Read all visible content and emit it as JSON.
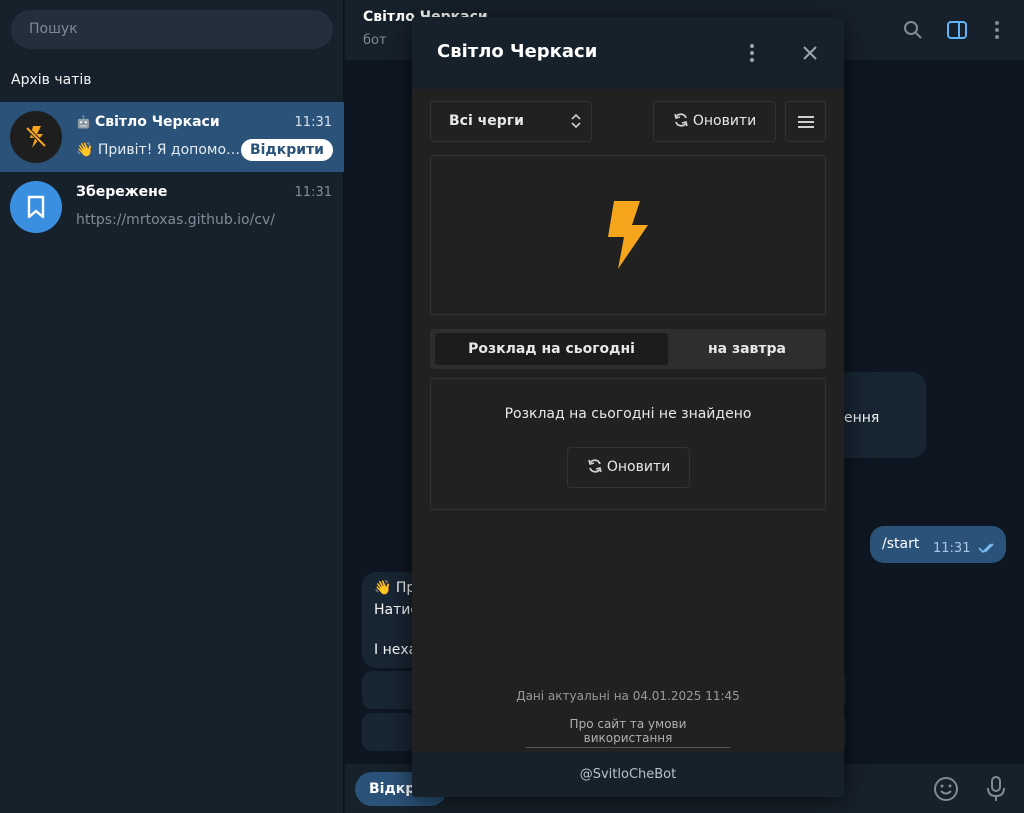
{
  "sidebar": {
    "search_placeholder": "Пошук",
    "archive_title": "Архів чатів",
    "chats": [
      {
        "name": "Світло Черкаси",
        "time": "11:31",
        "preview": "👋 Привіт! Я допомож...",
        "action": "Відкрити",
        "bot_icon": "bot-icon"
      },
      {
        "name": "Збережене",
        "time": "11:31",
        "preview": "https://mrtoxas.github.io/cv/"
      }
    ]
  },
  "chat": {
    "title": "Світло Черкаси",
    "subtitle": "бот",
    "messages": {
      "incoming_partial_1": "ення",
      "outgoing_text": "/start",
      "outgoing_time": "11:31",
      "incoming_greeting_1": "👋 Пр",
      "incoming_greeting_2": "Натис",
      "incoming_greeting_3": "І неха"
    },
    "composer_button": "Відкри"
  },
  "miniapp": {
    "title": "Світло Черкаси",
    "queue_select": "Всі черги",
    "refresh_label": "Оновити",
    "tabs": [
      {
        "label": "Розклад на сьогодні",
        "active": true
      },
      {
        "label": "на завтра",
        "active": false
      }
    ],
    "empty_message": "Розклад на сьогодні не знайдено",
    "refresh_label_2": "Оновити",
    "updated_text": "Дані актуальні на 04.01.2025 11:45",
    "about_link": "Про сайт та умови використання",
    "bot_username": "@SvitloCheBot"
  },
  "colors": {
    "accent": "#2b5278",
    "lightning": "#f7a51c",
    "sidebar_bg": "#17212b",
    "chat_bg": "#0e1621",
    "miniapp_bg": "#212121"
  }
}
